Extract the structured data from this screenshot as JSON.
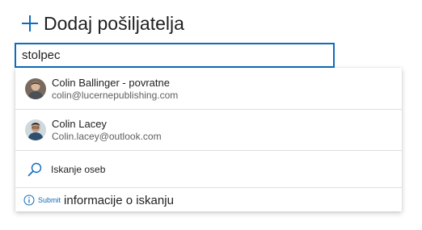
{
  "header": {
    "title": "Dodaj pošiljatelja",
    "icon": "plus-icon"
  },
  "search": {
    "value": "stolpec"
  },
  "suggestions": [
    {
      "name": "Colin Ballinger - povratne",
      "email": "colin@lucernepublishing.com",
      "avatar": "person-avatar"
    },
    {
      "name": "Colin Lacey",
      "email": "Colin.lacey@outlook.com",
      "avatar": "person-avatar"
    }
  ],
  "search_people": {
    "label": "Iskanje oseb",
    "icon": "search-icon"
  },
  "footer": {
    "submit_label": "Submit",
    "info_text": "informacije o iskanju",
    "icon": "info-icon"
  },
  "colors": {
    "accent": "#0f6cbd",
    "text": "#201f1e",
    "secondary_text": "#605e5c"
  }
}
